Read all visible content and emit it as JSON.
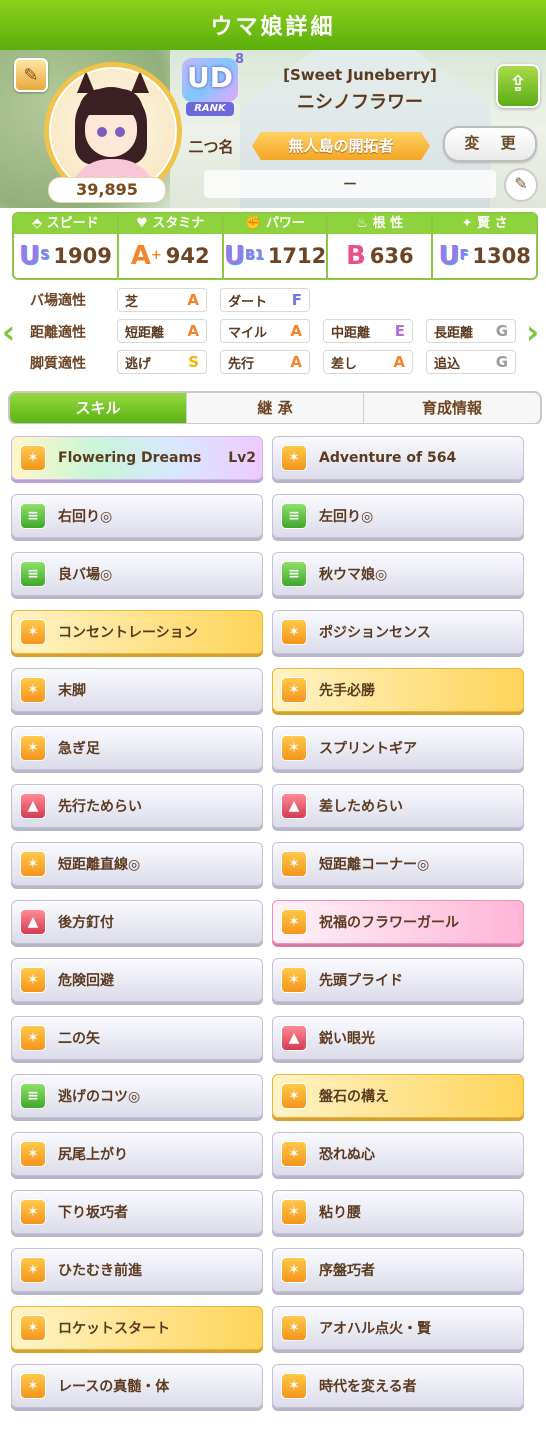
{
  "title": "ウマ娘詳細",
  "profile": {
    "fans": "39,895",
    "rank": {
      "badge": "UD",
      "sub": "8",
      "label": "RANK"
    },
    "nickname": "二つ名",
    "outfit": "[Sweet Juneberry]",
    "name": "ニシノフラワー",
    "epithet": "無人島の開拓者",
    "change_label": "変 更",
    "memo": "－"
  },
  "stats": [
    {
      "label": "スピード",
      "icon": "speed-icon",
      "grade": "U",
      "grade_sub": "S",
      "value": "1909"
    },
    {
      "label": "スタミナ",
      "icon": "heart-icon",
      "grade": "A",
      "grade_sub": "+",
      "value": "942"
    },
    {
      "label": "パワー",
      "icon": "power-icon",
      "grade": "U",
      "grade_sub": "B1",
      "value": "1712"
    },
    {
      "label": "根 性",
      "icon": "flame-icon",
      "grade": "B",
      "grade_sub": "",
      "value": "636"
    },
    {
      "label": "賢 さ",
      "icon": "cap-icon",
      "grade": "U",
      "grade_sub": "F",
      "value": "1308"
    }
  ],
  "aptitude": {
    "track_label": "バ場適性",
    "distance_label": "距離適性",
    "style_label": "脚質適性",
    "track": [
      {
        "name": "芝",
        "grade": "A"
      },
      {
        "name": "ダート",
        "grade": "F"
      }
    ],
    "distance": [
      {
        "name": "短距離",
        "grade": "A"
      },
      {
        "name": "マイル",
        "grade": "A"
      },
      {
        "name": "中距離",
        "grade": "E"
      },
      {
        "name": "長距離",
        "grade": "G"
      }
    ],
    "style": [
      {
        "name": "逃げ",
        "grade": "S"
      },
      {
        "name": "先行",
        "grade": "A"
      },
      {
        "name": "差し",
        "grade": "A"
      },
      {
        "name": "追込",
        "grade": "G"
      }
    ]
  },
  "tabs": [
    {
      "label": "スキル"
    },
    {
      "label": "継 承"
    },
    {
      "label": "育成情報"
    }
  ],
  "skills": [
    {
      "name": "Flowering Dreams",
      "level": "Lv2",
      "style": "rainbow",
      "icon": "o"
    },
    {
      "name": "Adventure of 564",
      "level": "",
      "style": "normal",
      "icon": "o"
    },
    {
      "name": "右回り◎",
      "level": "",
      "style": "normal",
      "icon": "g"
    },
    {
      "name": "左回り◎",
      "level": "",
      "style": "normal",
      "icon": "g"
    },
    {
      "name": "良バ場◎",
      "level": "",
      "style": "normal",
      "icon": "g"
    },
    {
      "name": "秋ウマ娘◎",
      "level": "",
      "style": "normal",
      "icon": "g"
    },
    {
      "name": "コンセントレーション",
      "level": "",
      "style": "gold",
      "icon": "o"
    },
    {
      "name": "ポジションセンス",
      "level": "",
      "style": "normal",
      "icon": "o"
    },
    {
      "name": "末脚",
      "level": "",
      "style": "normal",
      "icon": "o"
    },
    {
      "name": "先手必勝",
      "level": "",
      "style": "gold",
      "icon": "o"
    },
    {
      "name": "急ぎ足",
      "level": "",
      "style": "normal",
      "icon": "o"
    },
    {
      "name": "スプリントギア",
      "level": "",
      "style": "normal",
      "icon": "o"
    },
    {
      "name": "先行ためらい",
      "level": "",
      "style": "normal",
      "icon": "r"
    },
    {
      "name": "差しためらい",
      "level": "",
      "style": "normal",
      "icon": "r"
    },
    {
      "name": "短距離直線◎",
      "level": "",
      "style": "normal",
      "icon": "o"
    },
    {
      "name": "短距離コーナー◎",
      "level": "",
      "style": "normal",
      "icon": "o"
    },
    {
      "name": "後方釘付",
      "level": "",
      "style": "normal",
      "icon": "r"
    },
    {
      "name": "祝福のフラワーガール",
      "level": "",
      "style": "pink",
      "icon": "o"
    },
    {
      "name": "危険回避",
      "level": "",
      "style": "normal",
      "icon": "o"
    },
    {
      "name": "先頭プライド",
      "level": "",
      "style": "normal",
      "icon": "o"
    },
    {
      "name": "二の矢",
      "level": "",
      "style": "normal",
      "icon": "o"
    },
    {
      "name": "鋭い眼光",
      "level": "",
      "style": "normal",
      "icon": "r"
    },
    {
      "name": "逃げのコツ◎",
      "level": "",
      "style": "normal",
      "icon": "g"
    },
    {
      "name": "盤石の構え",
      "level": "",
      "style": "gold",
      "icon": "o"
    },
    {
      "name": "尻尾上がり",
      "level": "",
      "style": "normal",
      "icon": "o"
    },
    {
      "name": "恐れぬ心",
      "level": "",
      "style": "normal",
      "icon": "o"
    },
    {
      "name": "下り坂巧者",
      "level": "",
      "style": "normal",
      "icon": "o"
    },
    {
      "name": "粘り腰",
      "level": "",
      "style": "normal",
      "icon": "o"
    },
    {
      "name": "ひたむき前進",
      "level": "",
      "style": "normal",
      "icon": "o"
    },
    {
      "name": "序盤巧者",
      "level": "",
      "style": "normal",
      "icon": "o"
    },
    {
      "name": "ロケットスタート",
      "level": "",
      "style": "gold",
      "icon": "o"
    },
    {
      "name": "アオハル点火・賢",
      "level": "",
      "style": "normal",
      "icon": "o"
    },
    {
      "name": "レースの真髄・体",
      "level": "",
      "style": "normal",
      "icon": "o"
    },
    {
      "name": "時代を変える者",
      "level": "",
      "style": "normal",
      "icon": "o"
    }
  ]
}
